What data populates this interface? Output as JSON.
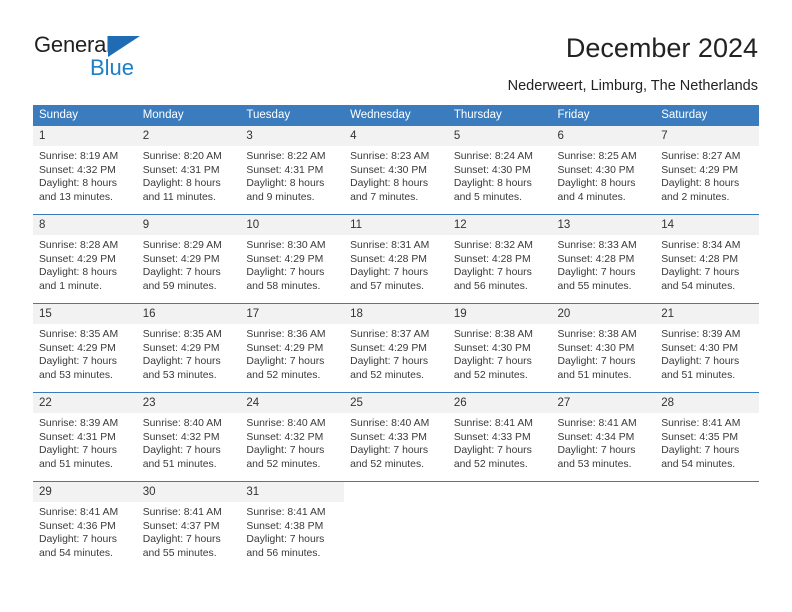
{
  "brand": {
    "name_part1": "General",
    "name_part2": "Blue",
    "triangle_color": "#1f6cb4",
    "blue_color": "#1f7ec4"
  },
  "header": {
    "title": "December 2024",
    "location": "Nederweert, Limburg, The Netherlands"
  },
  "colors": {
    "header_row": "#3a7cbe",
    "daynum_band": "#f2f2f2",
    "text": "#3a3a3a"
  },
  "weekday_headers": [
    "Sunday",
    "Monday",
    "Tuesday",
    "Wednesday",
    "Thursday",
    "Friday",
    "Saturday"
  ],
  "weeks": [
    [
      {
        "day": "1",
        "sunrise": "Sunrise: 8:19 AM",
        "sunset": "Sunset: 4:32 PM",
        "daylight_line1": "Daylight: 8 hours",
        "daylight_line2": "and 13 minutes."
      },
      {
        "day": "2",
        "sunrise": "Sunrise: 8:20 AM",
        "sunset": "Sunset: 4:31 PM",
        "daylight_line1": "Daylight: 8 hours",
        "daylight_line2": "and 11 minutes."
      },
      {
        "day": "3",
        "sunrise": "Sunrise: 8:22 AM",
        "sunset": "Sunset: 4:31 PM",
        "daylight_line1": "Daylight: 8 hours",
        "daylight_line2": "and 9 minutes."
      },
      {
        "day": "4",
        "sunrise": "Sunrise: 8:23 AM",
        "sunset": "Sunset: 4:30 PM",
        "daylight_line1": "Daylight: 8 hours",
        "daylight_line2": "and 7 minutes."
      },
      {
        "day": "5",
        "sunrise": "Sunrise: 8:24 AM",
        "sunset": "Sunset: 4:30 PM",
        "daylight_line1": "Daylight: 8 hours",
        "daylight_line2": "and 5 minutes."
      },
      {
        "day": "6",
        "sunrise": "Sunrise: 8:25 AM",
        "sunset": "Sunset: 4:30 PM",
        "daylight_line1": "Daylight: 8 hours",
        "daylight_line2": "and 4 minutes."
      },
      {
        "day": "7",
        "sunrise": "Sunrise: 8:27 AM",
        "sunset": "Sunset: 4:29 PM",
        "daylight_line1": "Daylight: 8 hours",
        "daylight_line2": "and 2 minutes."
      }
    ],
    [
      {
        "day": "8",
        "sunrise": "Sunrise: 8:28 AM",
        "sunset": "Sunset: 4:29 PM",
        "daylight_line1": "Daylight: 8 hours",
        "daylight_line2": "and 1 minute."
      },
      {
        "day": "9",
        "sunrise": "Sunrise: 8:29 AM",
        "sunset": "Sunset: 4:29 PM",
        "daylight_line1": "Daylight: 7 hours",
        "daylight_line2": "and 59 minutes."
      },
      {
        "day": "10",
        "sunrise": "Sunrise: 8:30 AM",
        "sunset": "Sunset: 4:29 PM",
        "daylight_line1": "Daylight: 7 hours",
        "daylight_line2": "and 58 minutes."
      },
      {
        "day": "11",
        "sunrise": "Sunrise: 8:31 AM",
        "sunset": "Sunset: 4:28 PM",
        "daylight_line1": "Daylight: 7 hours",
        "daylight_line2": "and 57 minutes."
      },
      {
        "day": "12",
        "sunrise": "Sunrise: 8:32 AM",
        "sunset": "Sunset: 4:28 PM",
        "daylight_line1": "Daylight: 7 hours",
        "daylight_line2": "and 56 minutes."
      },
      {
        "day": "13",
        "sunrise": "Sunrise: 8:33 AM",
        "sunset": "Sunset: 4:28 PM",
        "daylight_line1": "Daylight: 7 hours",
        "daylight_line2": "and 55 minutes."
      },
      {
        "day": "14",
        "sunrise": "Sunrise: 8:34 AM",
        "sunset": "Sunset: 4:28 PM",
        "daylight_line1": "Daylight: 7 hours",
        "daylight_line2": "and 54 minutes."
      }
    ],
    [
      {
        "day": "15",
        "sunrise": "Sunrise: 8:35 AM",
        "sunset": "Sunset: 4:29 PM",
        "daylight_line1": "Daylight: 7 hours",
        "daylight_line2": "and 53 minutes."
      },
      {
        "day": "16",
        "sunrise": "Sunrise: 8:35 AM",
        "sunset": "Sunset: 4:29 PM",
        "daylight_line1": "Daylight: 7 hours",
        "daylight_line2": "and 53 minutes."
      },
      {
        "day": "17",
        "sunrise": "Sunrise: 8:36 AM",
        "sunset": "Sunset: 4:29 PM",
        "daylight_line1": "Daylight: 7 hours",
        "daylight_line2": "and 52 minutes."
      },
      {
        "day": "18",
        "sunrise": "Sunrise: 8:37 AM",
        "sunset": "Sunset: 4:29 PM",
        "daylight_line1": "Daylight: 7 hours",
        "daylight_line2": "and 52 minutes."
      },
      {
        "day": "19",
        "sunrise": "Sunrise: 8:38 AM",
        "sunset": "Sunset: 4:30 PM",
        "daylight_line1": "Daylight: 7 hours",
        "daylight_line2": "and 52 minutes."
      },
      {
        "day": "20",
        "sunrise": "Sunrise: 8:38 AM",
        "sunset": "Sunset: 4:30 PM",
        "daylight_line1": "Daylight: 7 hours",
        "daylight_line2": "and 51 minutes."
      },
      {
        "day": "21",
        "sunrise": "Sunrise: 8:39 AM",
        "sunset": "Sunset: 4:30 PM",
        "daylight_line1": "Daylight: 7 hours",
        "daylight_line2": "and 51 minutes."
      }
    ],
    [
      {
        "day": "22",
        "sunrise": "Sunrise: 8:39 AM",
        "sunset": "Sunset: 4:31 PM",
        "daylight_line1": "Daylight: 7 hours",
        "daylight_line2": "and 51 minutes."
      },
      {
        "day": "23",
        "sunrise": "Sunrise: 8:40 AM",
        "sunset": "Sunset: 4:32 PM",
        "daylight_line1": "Daylight: 7 hours",
        "daylight_line2": "and 51 minutes."
      },
      {
        "day": "24",
        "sunrise": "Sunrise: 8:40 AM",
        "sunset": "Sunset: 4:32 PM",
        "daylight_line1": "Daylight: 7 hours",
        "daylight_line2": "and 52 minutes."
      },
      {
        "day": "25",
        "sunrise": "Sunrise: 8:40 AM",
        "sunset": "Sunset: 4:33 PM",
        "daylight_line1": "Daylight: 7 hours",
        "daylight_line2": "and 52 minutes."
      },
      {
        "day": "26",
        "sunrise": "Sunrise: 8:41 AM",
        "sunset": "Sunset: 4:33 PM",
        "daylight_line1": "Daylight: 7 hours",
        "daylight_line2": "and 52 minutes."
      },
      {
        "day": "27",
        "sunrise": "Sunrise: 8:41 AM",
        "sunset": "Sunset: 4:34 PM",
        "daylight_line1": "Daylight: 7 hours",
        "daylight_line2": "and 53 minutes."
      },
      {
        "day": "28",
        "sunrise": "Sunrise: 8:41 AM",
        "sunset": "Sunset: 4:35 PM",
        "daylight_line1": "Daylight: 7 hours",
        "daylight_line2": "and 54 minutes."
      }
    ],
    [
      {
        "day": "29",
        "sunrise": "Sunrise: 8:41 AM",
        "sunset": "Sunset: 4:36 PM",
        "daylight_line1": "Daylight: 7 hours",
        "daylight_line2": "and 54 minutes."
      },
      {
        "day": "30",
        "sunrise": "Sunrise: 8:41 AM",
        "sunset": "Sunset: 4:37 PM",
        "daylight_line1": "Daylight: 7 hours",
        "daylight_line2": "and 55 minutes."
      },
      {
        "day": "31",
        "sunrise": "Sunrise: 8:41 AM",
        "sunset": "Sunset: 4:38 PM",
        "daylight_line1": "Daylight: 7 hours",
        "daylight_line2": "and 56 minutes."
      },
      null,
      null,
      null,
      null
    ]
  ]
}
